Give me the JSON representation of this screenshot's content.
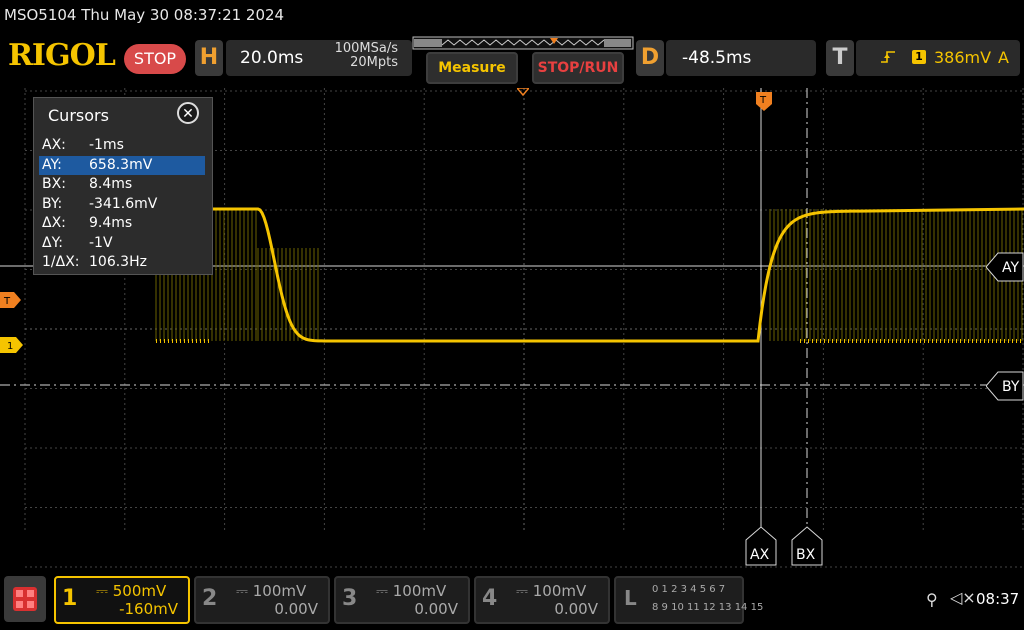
{
  "header": {
    "model_datetime": "MSO5104  Thu May 30 08:37:21 2024",
    "logo": "RIGOL",
    "run_state": "STOP",
    "horizontal_letter": "H",
    "timebase": "20.0ms",
    "sample_rate": "100MSa/s",
    "memory_depth": "20Mpts",
    "measure_label": "Measure",
    "stoprun_label": "STOP/RUN",
    "delay_letter": "D",
    "delay_value": "-48.5ms",
    "trigger_letter": "T",
    "trigger_edge_icon": "rising-edge-icon",
    "trigger_source": "1",
    "trigger_level": "386mV",
    "trigger_mode": "A"
  },
  "cursors": {
    "title": "Cursors",
    "close_icon": "close-icon",
    "rows": [
      {
        "key": "AX:",
        "value": "-1ms"
      },
      {
        "key": "AY:",
        "value": "658.3mV"
      },
      {
        "key": "BX:",
        "value": "8.4ms"
      },
      {
        "key": "BY:",
        "value": "-341.6mV"
      },
      {
        "key": "ΔX:",
        "value": "9.4ms"
      },
      {
        "key": "ΔY:",
        "value": "-1V"
      },
      {
        "key": "1/ΔX:",
        "value": "106.3Hz"
      }
    ],
    "selected_row": 1
  },
  "markers": {
    "trigger_left": "T",
    "channel_left": "1",
    "trigger_top": "T",
    "ay_label": "AY",
    "by_label": "BY",
    "ax_label": "AX",
    "bx_label": "BX"
  },
  "colors": {
    "channel1": "#f5c400",
    "trigger_marker": "#f08020",
    "selected_row": "#1e5aa0",
    "stop_badge": "#d84a4a"
  },
  "channels": [
    {
      "num": "1",
      "scale": "500mV",
      "offset": "-160mV",
      "active": true
    },
    {
      "num": "2",
      "scale": "100mV",
      "offset": "0.00V",
      "active": false
    },
    {
      "num": "3",
      "scale": "100mV",
      "offset": "0.00V",
      "active": false
    },
    {
      "num": "4",
      "scale": "100mV",
      "offset": "0.00V",
      "active": false
    }
  ],
  "logic": {
    "letter": "L",
    "top_row": "0 1 2 3   4 5 6 7",
    "bottom_row": "8 9 10 11 12 13 14 15"
  },
  "status": {
    "usb_icon": "usb-icon",
    "speaker_icon": "speaker-muted-icon",
    "time": "08:37"
  }
}
